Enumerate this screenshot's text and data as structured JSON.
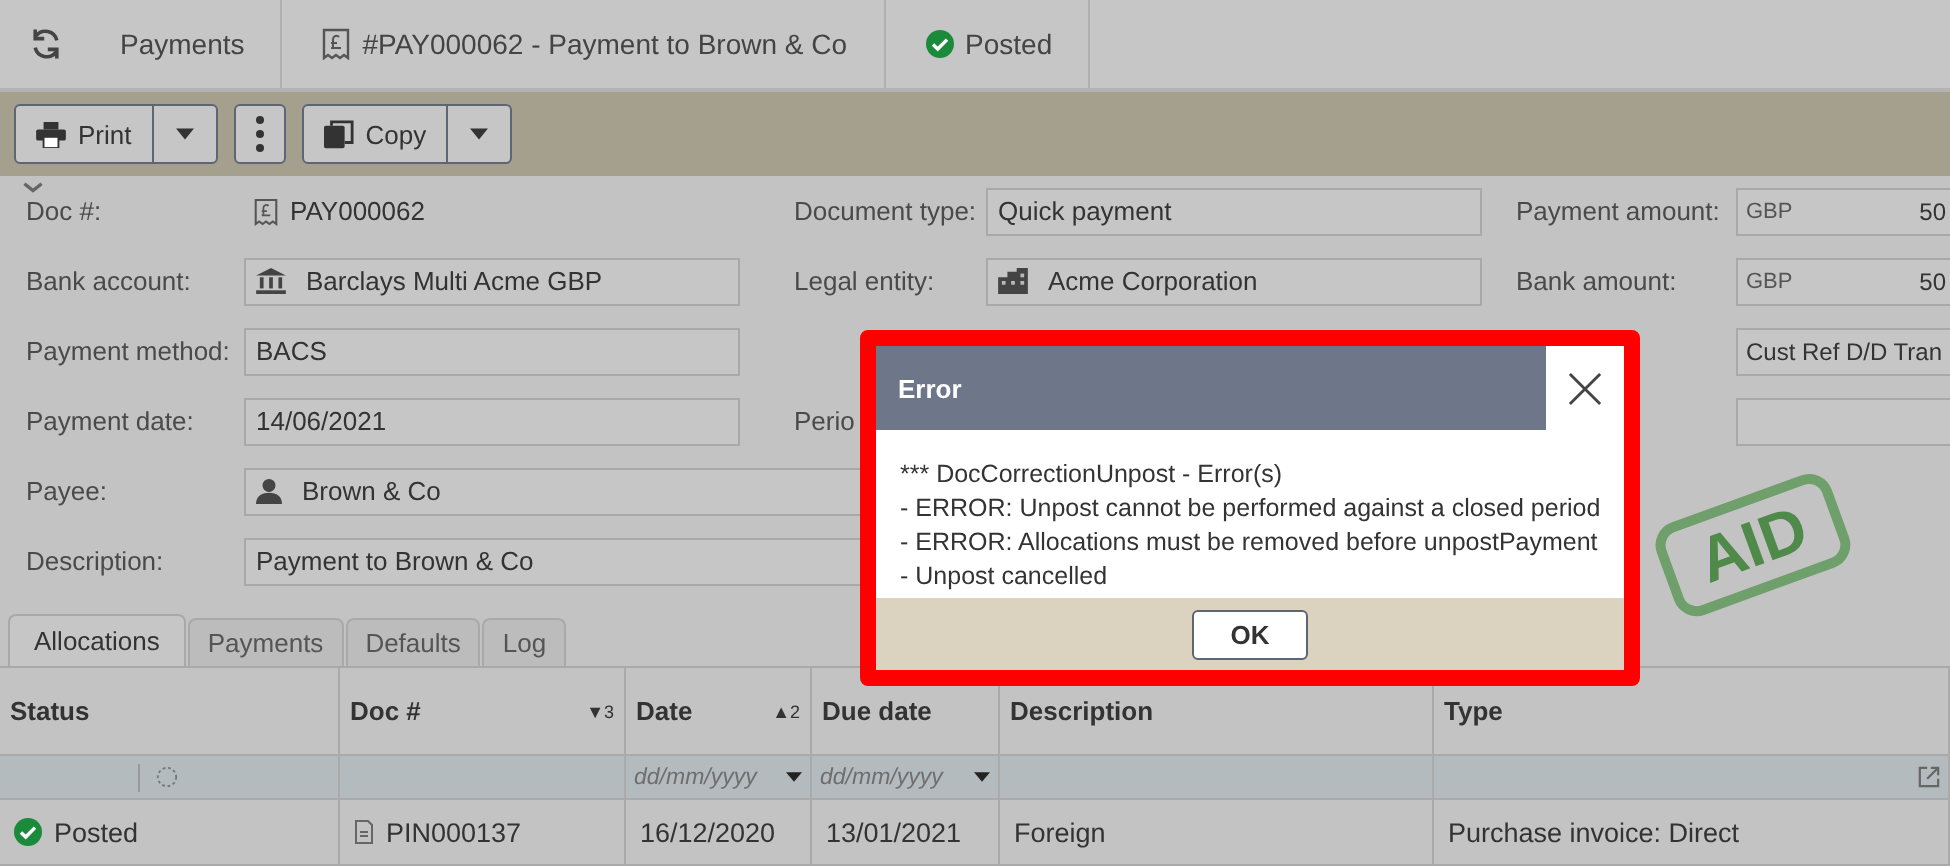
{
  "breadcrumbs": [
    {
      "kind": "module",
      "label": "Payments"
    },
    {
      "kind": "document",
      "label": "#PAY000062 - Payment to Brown & Co"
    },
    {
      "kind": "status",
      "label": "Posted"
    }
  ],
  "toolbar": [
    {
      "kind": "print",
      "label": "Print"
    },
    {
      "kind": "more"
    },
    {
      "kind": "copy",
      "label": "Copy"
    }
  ],
  "form": [
    {
      "kind": "doc",
      "label": "Doc #:",
      "value": "PAY000062"
    },
    {
      "kind": "bank",
      "label": "Bank account:",
      "value": "Barclays Multi Acme GBP"
    },
    {
      "kind": "text",
      "label": "Payment method:",
      "value": "BACS"
    },
    {
      "kind": "text",
      "label": "Payment date:",
      "value": "14/06/2021"
    },
    {
      "kind": "person",
      "label": "Payee:",
      "value": "Brown & Co"
    },
    {
      "kind": "text",
      "label": "Description:",
      "value": "Payment to Brown & Co"
    },
    {
      "kind": "text",
      "label": "Document type:",
      "value": "Quick payment"
    },
    {
      "kind": "building",
      "label": "Legal entity:",
      "value": "Acme Corporation"
    },
    {
      "kind": "label",
      "label": "Perio"
    },
    {
      "kind": "amount",
      "label": "Payment amount:",
      "currency": "GBP",
      "value": "50"
    },
    {
      "kind": "amount",
      "label": "Bank amount:",
      "currency": "GBP",
      "value": "50"
    },
    {
      "kind": "text",
      "value": "Cust Ref D/D Tran"
    },
    {
      "kind": "text"
    }
  ],
  "stamp": "AID",
  "tabs": [
    {
      "label": "Allocations",
      "selected": true
    },
    {
      "label": "Payments",
      "selected": false
    },
    {
      "label": "Defaults",
      "selected": false
    },
    {
      "label": "Log",
      "selected": false
    }
  ],
  "table": {
    "columns": [
      {
        "kind": "status",
        "label": "Status"
      },
      {
        "kind": "doc",
        "label": "Doc #",
        "sort": "▼3"
      },
      {
        "kind": "date",
        "label": "Date",
        "sort": "▲2",
        "placeholder": "dd/mm/yyyy"
      },
      {
        "kind": "date",
        "label": "Due date",
        "placeholder": "dd/mm/yyyy"
      },
      {
        "kind": "text",
        "label": "Description"
      },
      {
        "kind": "type",
        "label": "Type"
      }
    ],
    "rows": [
      {
        "status": "Posted",
        "doc": "PIN000137",
        "date": "16/12/2020",
        "due": "13/01/2021",
        "description": "Foreign",
        "type": "Purchase invoice: Direct"
      }
    ]
  },
  "dialog": {
    "title": "Error",
    "lines": [
      "*** DocCorrectionUnpost - Error(s)",
      "- ERROR: Unpost cannot be performed against a closed period",
      "- ERROR: Allocations must be removed before unpostPayment",
      "- Unpost cancelled"
    ],
    "button": "OK"
  }
}
